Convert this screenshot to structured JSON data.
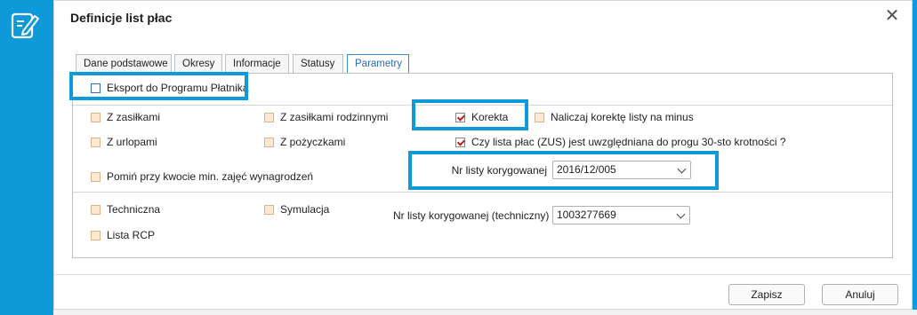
{
  "dialog": {
    "title": "Definicje list płac",
    "close_glyph": "✕"
  },
  "tabs": [
    {
      "label": "Dane podstawowe"
    },
    {
      "label": "Okresy"
    },
    {
      "label": "Informacje"
    },
    {
      "label": "Statusy"
    },
    {
      "label": "Parametry"
    }
  ],
  "parametry": {
    "eksport": {
      "label": "Eksport do Programu Płatnika",
      "checked": false
    },
    "z_zasilkami": {
      "label": "Z zasiłkami",
      "checked": false
    },
    "z_zasilkami_rodzinnymi": {
      "label": "Z zasiłkami rodzinnymi",
      "checked": false
    },
    "korekta": {
      "label": "Korekta",
      "checked": true
    },
    "naliczaj_korekte": {
      "label": "Naliczaj korektę listy na minus",
      "checked": false
    },
    "z_urlopami": {
      "label": "Z urlopami",
      "checked": false
    },
    "z_pozyczkami": {
      "label": "Z pożyczkami",
      "checked": false
    },
    "czy_lista": {
      "label": "Czy lista płac (ZUS) jest uwzględniana do progu 30-sto krotności ?",
      "checked": true
    },
    "pomin": {
      "label": "Pomiń przy kwocie min. zajęć wynagrodzeń",
      "checked": false
    },
    "nr_listy_korygowanej": {
      "label": "Nr listy korygowanej",
      "value": "2016/12/005"
    },
    "techniczna": {
      "label": "Techniczna",
      "checked": false
    },
    "symulacja": {
      "label": "Symulacja",
      "checked": false
    },
    "nr_listy_technicznej": {
      "label": "Nr listy korygowanej (techniczny)",
      "value": "1003277669"
    },
    "lista_rcp": {
      "label": "Lista RCP",
      "checked": false
    }
  },
  "footer": {
    "save_label": "Zapisz",
    "cancel_label": "Anuluj"
  },
  "colors": {
    "accent": "#0e9ad8",
    "checkbox_fill": "#fde9d2",
    "checkmark": "#b3261e"
  }
}
